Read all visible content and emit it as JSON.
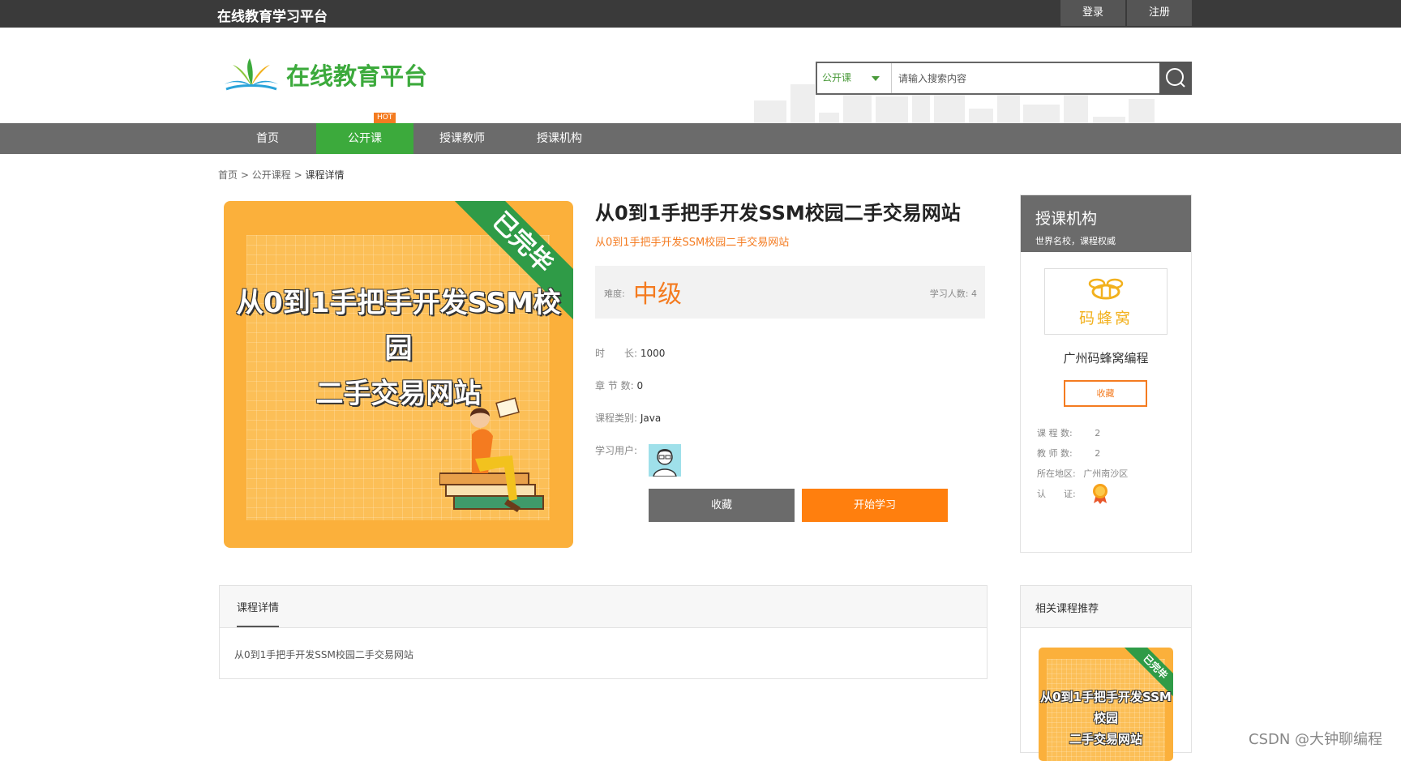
{
  "topbar": {
    "site_title": "在线教育学习平台",
    "login": "登录",
    "register": "注册"
  },
  "header": {
    "logo_text": "在线教育平台"
  },
  "search": {
    "category": "公开课",
    "placeholder": "请输入搜索内容"
  },
  "nav": {
    "items": [
      "首页",
      "公开课",
      "授课教师",
      "授课机构"
    ],
    "hot_badge": "HOT",
    "active_index": 1
  },
  "breadcrumb": {
    "home": "首页",
    "sep1": ">",
    "section": "公开课程",
    "sep2": ">",
    "current": "课程详情"
  },
  "course": {
    "cover_ribbon": "已完毕",
    "cover_title_line1": "从0到1手把手开发SSM校园",
    "cover_title_line2": "二手交易网站",
    "title": "从0到1手把手开发SSM校园二手交易网站",
    "subtitle": "从0到1手把手开发SSM校园二手交易网站",
    "difficulty_label": "难度:",
    "difficulty": "中级",
    "students_label": "学习人数:",
    "students": "4",
    "duration_label": "时　　长:",
    "duration": "1000",
    "chapters_label": "章 节 数:",
    "chapters": "0",
    "category_label": "课程类别:",
    "category": "Java",
    "users_label": "学习用户:",
    "btn_favorite": "收藏",
    "btn_start": "开始学习"
  },
  "organization": {
    "title": "授课机构",
    "subtitle": "世界名校，课程权威",
    "logo_text": "码蜂窝",
    "name": "广州码蜂窝编程",
    "favorite": "收藏",
    "course_count_label": "课 程 数:",
    "course_count": "2",
    "teacher_count_label": "教 师 数:",
    "teacher_count": "2",
    "region_label": "所在地区:",
    "region": "广州南沙区",
    "cert_label": "认　　证:"
  },
  "detail": {
    "tab": "课程详情",
    "body": "从0到1手把手开发SSM校园二手交易网站"
  },
  "related": {
    "title": "相关课程推荐",
    "thumb_ribbon": "已完毕",
    "thumb_line1": "从0到1手把手开发SSM校园",
    "thumb_line2": "二手交易网站"
  },
  "watermark": "CSDN @大钟聊编程",
  "colors": {
    "green": "#3caa3c",
    "orange": "#f47b20",
    "dark": "#3a3a3a",
    "gray": "#6b6b6b"
  }
}
